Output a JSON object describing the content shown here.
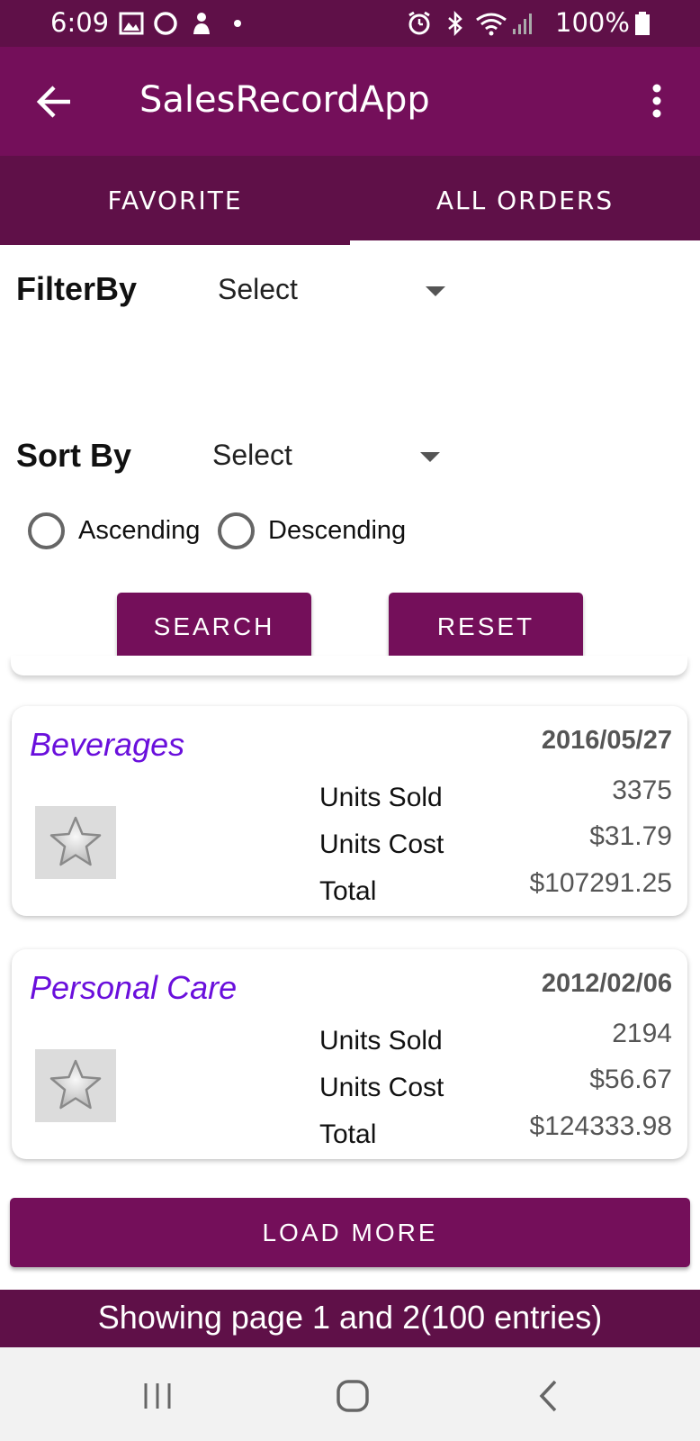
{
  "status_bar": {
    "time": "6:09",
    "battery": "100%",
    "icons": [
      "image-icon",
      "circle-icon",
      "person-icon",
      "dot-icon",
      "alarm-icon",
      "bluetooth-icon",
      "wifi-icon",
      "signal-icon",
      "battery-icon"
    ]
  },
  "app_bar": {
    "title": "SalesRecordApp",
    "back_icon": "arrow-left-icon",
    "menu_icon": "more-vert-icon"
  },
  "tabs": [
    {
      "label": "FAVORITE",
      "selected": false
    },
    {
      "label": "ALL ORDERS",
      "selected": true
    }
  ],
  "filter": {
    "label": "FilterBy",
    "value": "Select"
  },
  "sort": {
    "label": "Sort By",
    "value": "Select",
    "options": [
      {
        "label": "Ascending",
        "checked": false
      },
      {
        "label": "Descending",
        "checked": false
      }
    ]
  },
  "buttons": {
    "search": "SEARCH",
    "reset": "RESET",
    "load_more": "LOAD MORE"
  },
  "orders": [
    {
      "category": "Beverages",
      "date": "2016/05/27",
      "favorite": false,
      "units_sold_label": "Units Sold",
      "units_sold": "3375",
      "units_cost_label": "Units Cost",
      "units_cost": "$31.79",
      "total_label": "Total",
      "total": "$107291.25"
    },
    {
      "category": "Personal Care",
      "date": "2012/02/06",
      "favorite": false,
      "units_sold_label": "Units Sold",
      "units_sold": "2194",
      "units_cost_label": "Units Cost",
      "units_cost": "$56.67",
      "total_label": "Total",
      "total": "$124333.98"
    }
  ],
  "footer": {
    "text": "Showing page 1 and 2(100 entries)"
  },
  "colors": {
    "primary": "#740f5a",
    "primary_dark": "#5f1048",
    "category_text": "#6a0fdc"
  }
}
